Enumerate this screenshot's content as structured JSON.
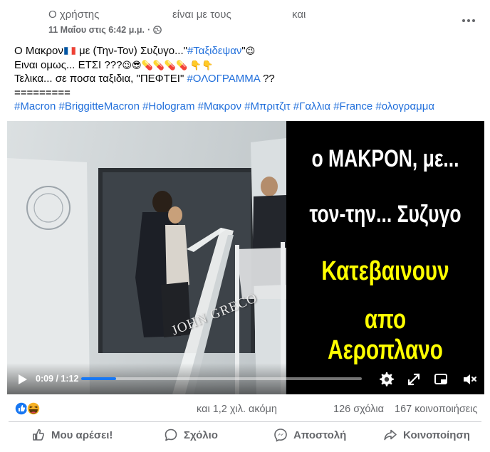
{
  "header": {
    "author": "Ο χρήστης",
    "with_text": "είναι με τους",
    "and_text": "και",
    "timestamp": "11 Μαΐου στις 6:42 μ.μ.",
    "separator": "·",
    "privacy_icon": "globe-icon",
    "more_icon": "more-dots-icon"
  },
  "post_text": {
    "line1_a": "Ο Μακρον",
    "line1_flag": "france-flag",
    "line1_b": " με (Την-Τον) Συζυγο...\"",
    "line1_tag": "#Ταξιδεψαν",
    "line1_c": "\"",
    "line1_emoji": "😉",
    "line2_a": "Ειναι ομως... ΕΤΣΙ ???",
    "line2_emoji": "😉😎💊💊💊💊 👇👇",
    "line3_a": "Τελικα... σε ποσα ταξιδια, \"ΠΕΦΤΕΙ\" ",
    "line3_tag": "#ΟΛΟΓΡΑΜΜΑ",
    "line3_b": " ??",
    "line4": "=========",
    "hashtags": [
      "#Macron",
      "#BriggitteMacron",
      "#Hologram",
      "#Μακρον",
      "#Μπριτζιτ",
      "#Γαλλια",
      "#France",
      "#ολογραμμα"
    ]
  },
  "video": {
    "overlay_lines": [
      "ο ΜΑΚΡΟΝ, με...",
      "τον-την... Συζυγο",
      "Κατεβαινουν",
      "απο Αεροπλανο"
    ],
    "overlay_colors": [
      "#ffffff",
      "#ffffff",
      "#ffff00",
      "#ffff00"
    ],
    "watermark": "JOHN GRECO",
    "time_display": "0:09 / 1:12",
    "progress": 0.125,
    "accent_color": "#1877f2",
    "icons": [
      "play-icon",
      "settings-icon",
      "expand-icon",
      "miniplayer-icon",
      "volume-muted-icon"
    ]
  },
  "stats": {
    "reaction_icons": [
      "like-reaction-icon",
      "haha-reaction-icon"
    ],
    "others": "και 1,2 χιλ. ακόμη",
    "comments": "126 σχόλια",
    "shares": "167 κοινοποιήσεις"
  },
  "actions": {
    "like": "Μου αρέσει!",
    "comment": "Σχόλιο",
    "send": "Αποστολή",
    "share": "Κοινοποίηση"
  }
}
